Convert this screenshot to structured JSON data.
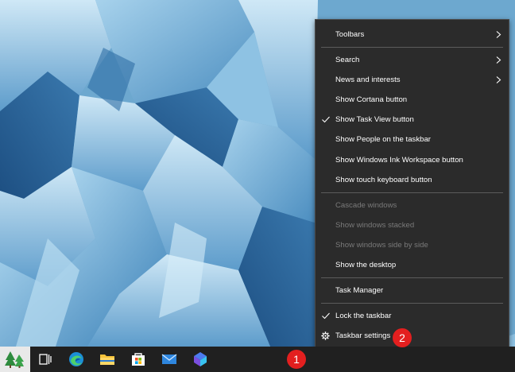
{
  "context_menu": {
    "items": [
      {
        "label": "Toolbars",
        "submenu": true
      },
      {
        "separator": true
      },
      {
        "label": "Search",
        "submenu": true
      },
      {
        "label": "News and interests",
        "submenu": true
      },
      {
        "label": "Show Cortana button"
      },
      {
        "label": "Show Task View button",
        "checked": true
      },
      {
        "label": "Show People on the taskbar"
      },
      {
        "label": "Show Windows Ink Workspace button"
      },
      {
        "label": "Show touch keyboard button"
      },
      {
        "separator": true
      },
      {
        "label": "Cascade windows",
        "disabled": true
      },
      {
        "label": "Show windows stacked",
        "disabled": true
      },
      {
        "label": "Show windows side by side",
        "disabled": true
      },
      {
        "label": "Show the desktop"
      },
      {
        "separator": true
      },
      {
        "label": "Task Manager"
      },
      {
        "separator": true
      },
      {
        "label": "Lock the taskbar",
        "checked": true
      },
      {
        "label": "Taskbar settings",
        "icon": "gear-icon"
      }
    ]
  },
  "taskbar": {
    "buttons": [
      {
        "name": "desktop-tree-icon",
        "active": true
      },
      {
        "name": "task-view-icon"
      },
      {
        "name": "edge-icon"
      },
      {
        "name": "file-explorer-icon"
      },
      {
        "name": "microsoft-store-icon"
      },
      {
        "name": "mail-icon"
      },
      {
        "name": "photos-app-icon"
      }
    ]
  },
  "callouts": {
    "one": "1",
    "two": "2"
  },
  "colors": {
    "menu_bg": "#2b2b2b",
    "taskbar_bg": "#202020",
    "callout": "#e31f1f"
  }
}
